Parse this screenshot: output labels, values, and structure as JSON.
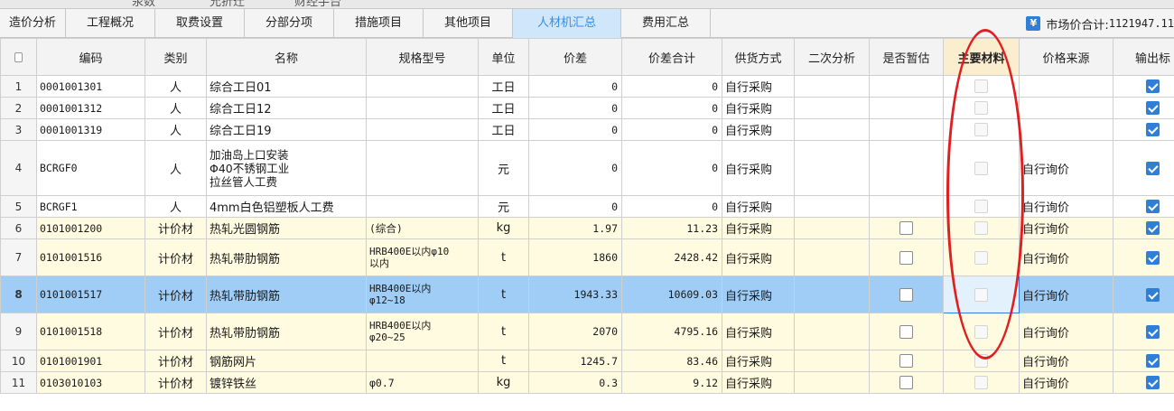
{
  "top_strip": [
    "汞数",
    "允折迁",
    "财经手台"
  ],
  "tabs": [
    {
      "label": "造价分析",
      "active": false
    },
    {
      "label": "工程概况",
      "active": false
    },
    {
      "label": "取费设置",
      "active": false
    },
    {
      "label": "分部分项",
      "active": false
    },
    {
      "label": "措施项目",
      "active": false
    },
    {
      "label": "其他项目",
      "active": false
    },
    {
      "label": "人材机汇总",
      "active": true
    },
    {
      "label": "费用汇总",
      "active": false
    }
  ],
  "summary": {
    "label": "市场价合计:",
    "value": "1121947.11"
  },
  "columns": [
    "编码",
    "类别",
    "名称",
    "规格型号",
    "单位",
    "价差",
    "价差合计",
    "供货方式",
    "二次分析",
    "是否暂估",
    "主要材料",
    "价格来源",
    "输出标"
  ],
  "rows": [
    {
      "no": "1",
      "code": "0001001301",
      "cat": "人",
      "name": "综合工日01",
      "spec": "",
      "unit": "工日",
      "diff": "0",
      "diff_total": "0",
      "supply": "自行采购",
      "estimate": null,
      "source": "",
      "output": true,
      "type": "labor"
    },
    {
      "no": "2",
      "code": "0001001312",
      "cat": "人",
      "name": "综合工日12",
      "spec": "",
      "unit": "工日",
      "diff": "0",
      "diff_total": "0",
      "supply": "自行采购",
      "estimate": null,
      "source": "",
      "output": true,
      "type": "labor"
    },
    {
      "no": "3",
      "code": "0001001319",
      "cat": "人",
      "name": "综合工日19",
      "spec": "",
      "unit": "工日",
      "diff": "0",
      "diff_total": "0",
      "supply": "自行采购",
      "estimate": null,
      "source": "",
      "output": true,
      "type": "labor"
    },
    {
      "no": "4",
      "code": "BCRGF0",
      "cat": "人",
      "name": "加油岛上口安装\nΦ40不锈钢工业\n拉丝管人工费",
      "spec": "",
      "unit": "元",
      "diff": "0",
      "diff_total": "0",
      "supply": "自行采购",
      "estimate": null,
      "source": "自行询价",
      "output": true,
      "type": "labor"
    },
    {
      "no": "5",
      "code": "BCRGF1",
      "cat": "人",
      "name": "4mm白色铝塑板人工费",
      "spec": "",
      "unit": "元",
      "diff": "0",
      "diff_total": "0",
      "supply": "自行采购",
      "estimate": null,
      "source": "自行询价",
      "output": true,
      "type": "labor"
    },
    {
      "no": "6",
      "code": "0101001200",
      "cat": "计价材",
      "name": "热轧光圆钢筋",
      "spec": "(综合)",
      "unit": "kg",
      "diff": "1.97",
      "diff_total": "11.23",
      "supply": "自行采购",
      "estimate": false,
      "source": "自行询价",
      "output": true,
      "type": "mat"
    },
    {
      "no": "7",
      "code": "0101001516",
      "cat": "计价材",
      "name": "热轧带肋钢筋",
      "spec": "HRB400E以内φ10\n以内",
      "unit": "t",
      "diff": "1860",
      "diff_total": "2428.42",
      "supply": "自行采购",
      "estimate": false,
      "source": "自行询价",
      "output": true,
      "type": "mat"
    },
    {
      "no": "8",
      "code": "0101001517",
      "cat": "计价材",
      "name": "热轧带肋钢筋",
      "spec": "HRB400E以内\nφ12~18",
      "unit": "t",
      "diff": "1943.33",
      "diff_total": "10609.03",
      "supply": "自行采购",
      "estimate": false,
      "source": "自行询价",
      "output": true,
      "type": "sel"
    },
    {
      "no": "9",
      "code": "0101001518",
      "cat": "计价材",
      "name": "热轧带肋钢筋",
      "spec": "HRB400E以内\nφ20~25",
      "unit": "t",
      "diff": "2070",
      "diff_total": "4795.16",
      "supply": "自行采购",
      "estimate": false,
      "source": "自行询价",
      "output": true,
      "type": "mat"
    },
    {
      "no": "10",
      "code": "0101001901",
      "cat": "计价材",
      "name": "钢筋网片",
      "spec": "",
      "unit": "t",
      "diff": "1245.7",
      "diff_total": "83.46",
      "supply": "自行采购",
      "estimate": false,
      "source": "自行询价",
      "output": true,
      "type": "mat"
    },
    {
      "no": "11",
      "code": "0103010103",
      "cat": "计价材",
      "name": "镀锌铁丝",
      "spec": "φ0.7",
      "unit": "kg",
      "diff": "0.3",
      "diff_total": "9.12",
      "supply": "自行采购",
      "estimate": false,
      "source": "自行询价",
      "output": true,
      "type": "mat"
    }
  ]
}
